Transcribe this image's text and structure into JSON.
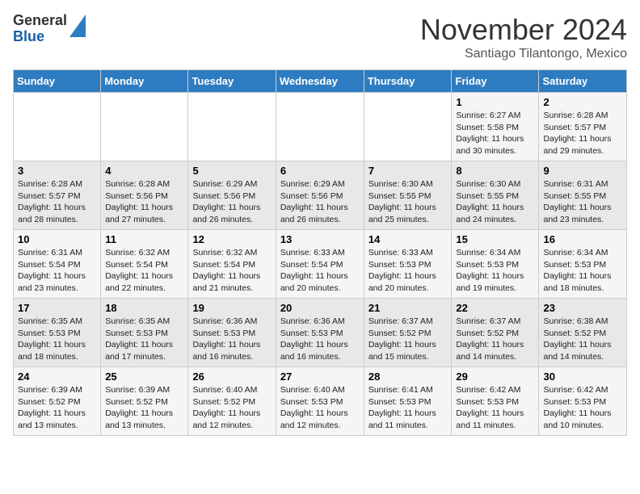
{
  "header": {
    "logo": {
      "line1": "General",
      "line2": "Blue"
    },
    "title": "November 2024",
    "location": "Santiago Tilantongo, Mexico"
  },
  "calendar": {
    "headers": [
      "Sunday",
      "Monday",
      "Tuesday",
      "Wednesday",
      "Thursday",
      "Friday",
      "Saturday"
    ],
    "weeks": [
      [
        {
          "day": "",
          "info": ""
        },
        {
          "day": "",
          "info": ""
        },
        {
          "day": "",
          "info": ""
        },
        {
          "day": "",
          "info": ""
        },
        {
          "day": "",
          "info": ""
        },
        {
          "day": "1",
          "info": "Sunrise: 6:27 AM\nSunset: 5:58 PM\nDaylight: 11 hours\nand 30 minutes."
        },
        {
          "day": "2",
          "info": "Sunrise: 6:28 AM\nSunset: 5:57 PM\nDaylight: 11 hours\nand 29 minutes."
        }
      ],
      [
        {
          "day": "3",
          "info": "Sunrise: 6:28 AM\nSunset: 5:57 PM\nDaylight: 11 hours\nand 28 minutes."
        },
        {
          "day": "4",
          "info": "Sunrise: 6:28 AM\nSunset: 5:56 PM\nDaylight: 11 hours\nand 27 minutes."
        },
        {
          "day": "5",
          "info": "Sunrise: 6:29 AM\nSunset: 5:56 PM\nDaylight: 11 hours\nand 26 minutes."
        },
        {
          "day": "6",
          "info": "Sunrise: 6:29 AM\nSunset: 5:56 PM\nDaylight: 11 hours\nand 26 minutes."
        },
        {
          "day": "7",
          "info": "Sunrise: 6:30 AM\nSunset: 5:55 PM\nDaylight: 11 hours\nand 25 minutes."
        },
        {
          "day": "8",
          "info": "Sunrise: 6:30 AM\nSunset: 5:55 PM\nDaylight: 11 hours\nand 24 minutes."
        },
        {
          "day": "9",
          "info": "Sunrise: 6:31 AM\nSunset: 5:55 PM\nDaylight: 11 hours\nand 23 minutes."
        }
      ],
      [
        {
          "day": "10",
          "info": "Sunrise: 6:31 AM\nSunset: 5:54 PM\nDaylight: 11 hours\nand 23 minutes."
        },
        {
          "day": "11",
          "info": "Sunrise: 6:32 AM\nSunset: 5:54 PM\nDaylight: 11 hours\nand 22 minutes."
        },
        {
          "day": "12",
          "info": "Sunrise: 6:32 AM\nSunset: 5:54 PM\nDaylight: 11 hours\nand 21 minutes."
        },
        {
          "day": "13",
          "info": "Sunrise: 6:33 AM\nSunset: 5:54 PM\nDaylight: 11 hours\nand 20 minutes."
        },
        {
          "day": "14",
          "info": "Sunrise: 6:33 AM\nSunset: 5:53 PM\nDaylight: 11 hours\nand 20 minutes."
        },
        {
          "day": "15",
          "info": "Sunrise: 6:34 AM\nSunset: 5:53 PM\nDaylight: 11 hours\nand 19 minutes."
        },
        {
          "day": "16",
          "info": "Sunrise: 6:34 AM\nSunset: 5:53 PM\nDaylight: 11 hours\nand 18 minutes."
        }
      ],
      [
        {
          "day": "17",
          "info": "Sunrise: 6:35 AM\nSunset: 5:53 PM\nDaylight: 11 hours\nand 18 minutes."
        },
        {
          "day": "18",
          "info": "Sunrise: 6:35 AM\nSunset: 5:53 PM\nDaylight: 11 hours\nand 17 minutes."
        },
        {
          "day": "19",
          "info": "Sunrise: 6:36 AM\nSunset: 5:53 PM\nDaylight: 11 hours\nand 16 minutes."
        },
        {
          "day": "20",
          "info": "Sunrise: 6:36 AM\nSunset: 5:53 PM\nDaylight: 11 hours\nand 16 minutes."
        },
        {
          "day": "21",
          "info": "Sunrise: 6:37 AM\nSunset: 5:52 PM\nDaylight: 11 hours\nand 15 minutes."
        },
        {
          "day": "22",
          "info": "Sunrise: 6:37 AM\nSunset: 5:52 PM\nDaylight: 11 hours\nand 14 minutes."
        },
        {
          "day": "23",
          "info": "Sunrise: 6:38 AM\nSunset: 5:52 PM\nDaylight: 11 hours\nand 14 minutes."
        }
      ],
      [
        {
          "day": "24",
          "info": "Sunrise: 6:39 AM\nSunset: 5:52 PM\nDaylight: 11 hours\nand 13 minutes."
        },
        {
          "day": "25",
          "info": "Sunrise: 6:39 AM\nSunset: 5:52 PM\nDaylight: 11 hours\nand 13 minutes."
        },
        {
          "day": "26",
          "info": "Sunrise: 6:40 AM\nSunset: 5:52 PM\nDaylight: 11 hours\nand 12 minutes."
        },
        {
          "day": "27",
          "info": "Sunrise: 6:40 AM\nSunset: 5:53 PM\nDaylight: 11 hours\nand 12 minutes."
        },
        {
          "day": "28",
          "info": "Sunrise: 6:41 AM\nSunset: 5:53 PM\nDaylight: 11 hours\nand 11 minutes."
        },
        {
          "day": "29",
          "info": "Sunrise: 6:42 AM\nSunset: 5:53 PM\nDaylight: 11 hours\nand 11 minutes."
        },
        {
          "day": "30",
          "info": "Sunrise: 6:42 AM\nSunset: 5:53 PM\nDaylight: 11 hours\nand 10 minutes."
        }
      ]
    ]
  }
}
